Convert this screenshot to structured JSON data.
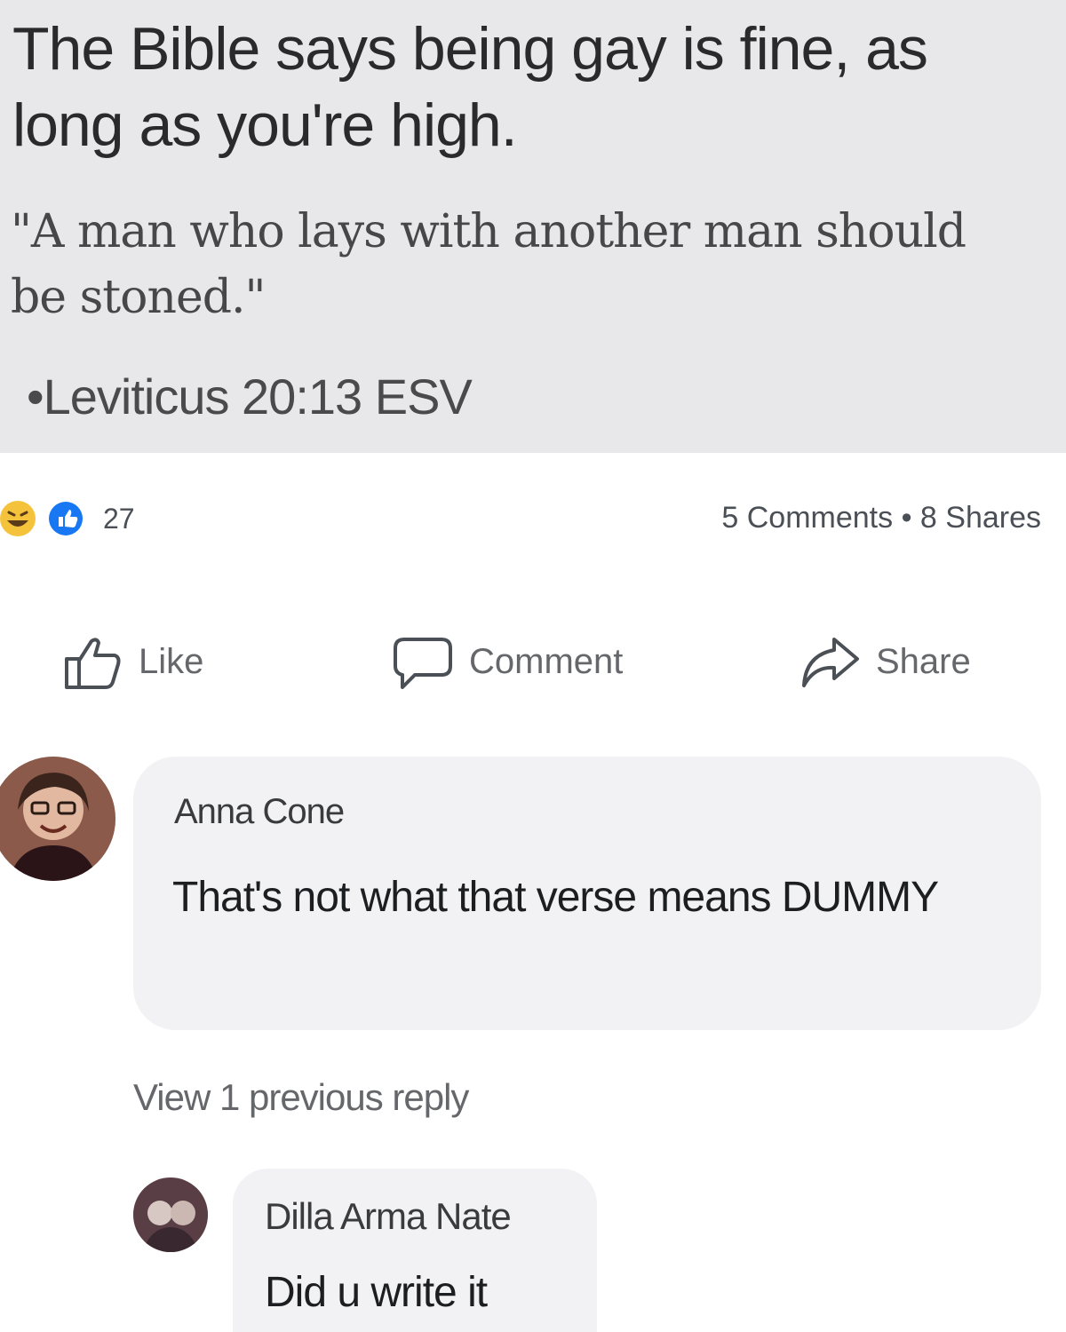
{
  "post": {
    "headline": "The Bible says being gay is fine, as long as you're high.",
    "quote": "\"A man who lays with another man should be stoned.\"",
    "citation": "•Leviticus 20:13 ESV"
  },
  "reactions": {
    "icons": [
      "haha-reaction-icon",
      "like-reaction-icon"
    ],
    "count": "27",
    "stats": "5 Comments • 8 Shares"
  },
  "actions": {
    "like_label": "Like",
    "comment_label": "Comment",
    "share_label": "Share"
  },
  "comments": [
    {
      "author": "Anna Cone",
      "text": "That's not what that verse means DUMMY"
    }
  ],
  "view_replies_label": "View 1 previous reply",
  "replies": [
    {
      "author": "Dilla Arma Nate",
      "text": "Did u write it"
    }
  ],
  "colors": {
    "image_background": "#e8e7ea",
    "bubble_background": "#f2f2f4",
    "secondary_text": "#65676b"
  }
}
